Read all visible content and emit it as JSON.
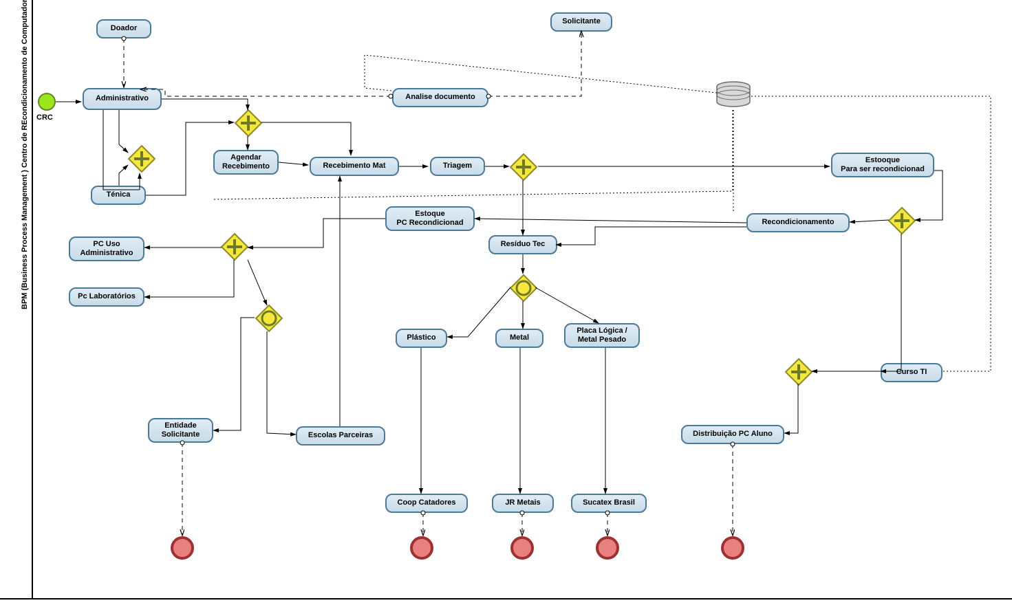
{
  "sidebar_title": "BPM (Business Process Management )  Centro de REcondicionamento de Computadores",
  "start_label": "CRC",
  "tasks": {
    "doador": "Doador",
    "solicitante": "Solicitante",
    "administrativo": "Administrativo",
    "tenica": "Ténica",
    "agendar": "Agendar\nRecebimento",
    "analise": "Analise documento",
    "recebimento": "Recebimento Mat",
    "triagem": "Triagem",
    "estoque_recond": "Estooque\nPara ser recondicionad",
    "recondicionamento": "Recondicionamento",
    "estoque_pc": "Estoque\nPC Recondicionad",
    "residuo": "Resíduo Tec",
    "pc_uso": "PC Uso\nAdministrativo",
    "pc_lab": "Pc Laboratórios",
    "plastico": "Plástico",
    "metal": "Metal",
    "placa": "Placa Lógica /\nMetal Pesado",
    "curso_ti": "Curso  TI",
    "entidade": "Entidade\nSolicitante",
    "escolas": "Escolas Parceiras",
    "coop": "Coop Catadores",
    "jr_metais": "JR Metais",
    "sucatex": "Sucatex Brasil",
    "dist_pc": "Distribuição PC Aluno"
  }
}
